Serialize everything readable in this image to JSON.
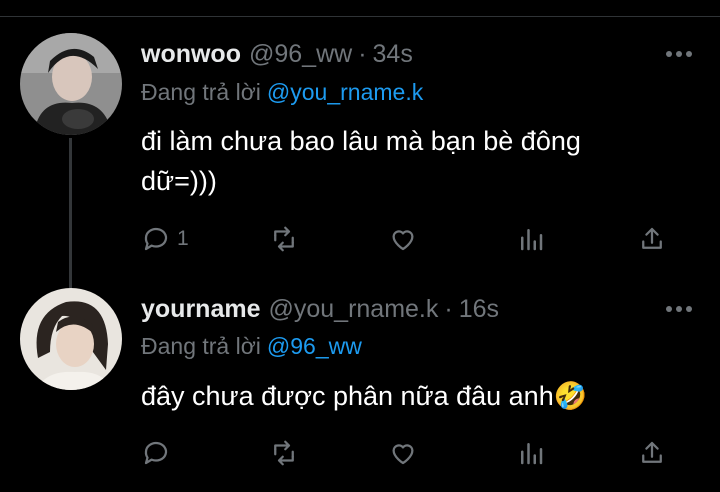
{
  "tweets": [
    {
      "name": "wonwoo",
      "handle": "@96_ww",
      "separator": "·",
      "time": "34s",
      "replying_prefix": "Đang trả lời",
      "replying_to": "@you_rname.k",
      "text": "đi làm chưa bao lâu mà bạn bè đông dữ=)))",
      "reply_count": "1",
      "retweet_count": "",
      "like_count": ""
    },
    {
      "name": "yourname",
      "handle": "@you_rname.k",
      "separator": "·",
      "time": "16s",
      "replying_prefix": "Đang trả lời",
      "replying_to": "@96_ww",
      "text": "đây chưa được phân nữa đâu anh🤣",
      "reply_count": "",
      "retweet_count": "",
      "like_count": ""
    }
  ],
  "icons": {
    "reply": "reply-icon",
    "retweet": "retweet-icon",
    "like": "heart-icon",
    "views": "views-icon",
    "share": "share-icon",
    "more": "more-icon"
  },
  "colors": {
    "background": "#000000",
    "text": "#e7e9ea",
    "muted": "#71767b",
    "link": "#1d9bf0"
  }
}
